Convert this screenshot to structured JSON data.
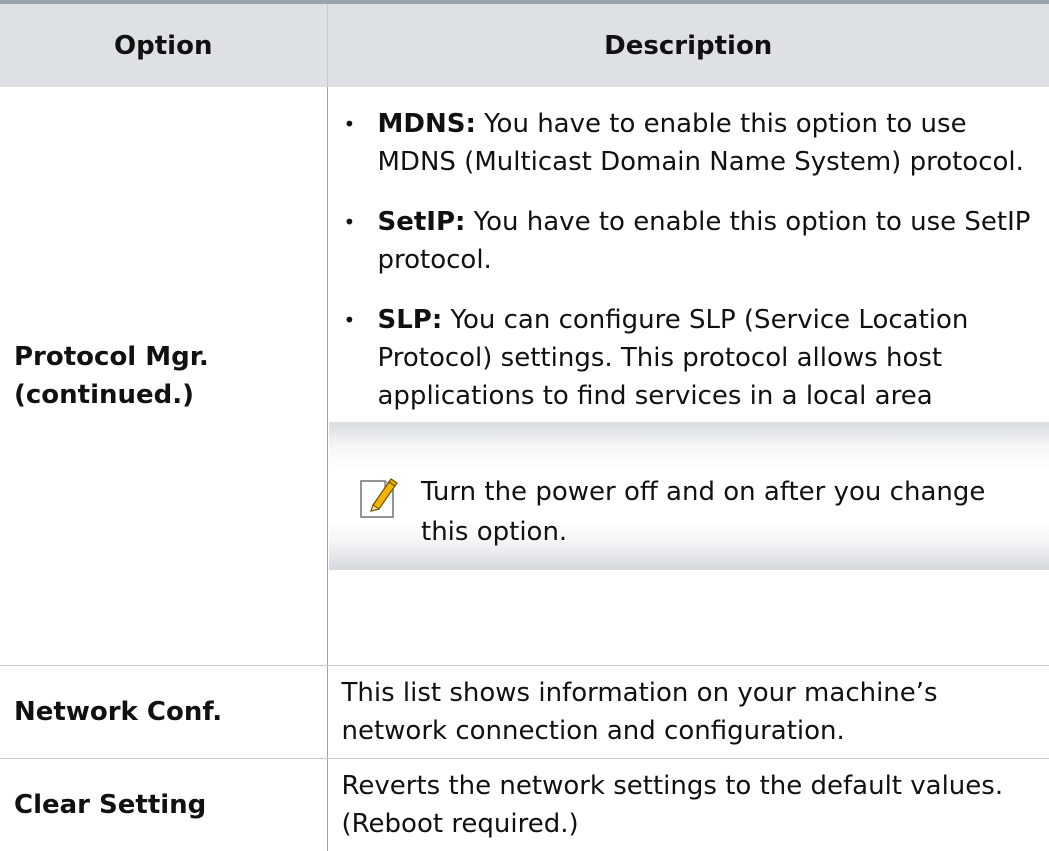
{
  "table": {
    "headers": {
      "option": "Option",
      "description": "Description"
    },
    "rows": [
      {
        "option": "Protocol Mgr. (continued.)",
        "bullets": [
          {
            "term": "MDNS:",
            "text": " You have to enable this option to use MDNS (Multicast Domain Name System) protocol."
          },
          {
            "term": "SetIP:",
            "text": " You have to enable this option to use SetIP protocol."
          },
          {
            "term": "SLP:",
            "text": " You can configure SLP (Service Location Protocol) settings. This protocol allows host applications to find services in a local area network without prior configuration."
          }
        ],
        "note": "Turn the power off and on after you change this option."
      },
      {
        "option": "Network Conf.",
        "description": "This list shows information on your machine’s network connection and configuration."
      },
      {
        "option": "Clear Setting",
        "description": "Reverts the network settings to the default values. (Reboot required.)"
      }
    ]
  },
  "icons": {
    "note": "note-pencil-icon"
  },
  "colors": {
    "header_bg": "#dde1e6",
    "header_rule": "#9aa2ad",
    "row_rule": "#c4c8cd",
    "note_icon_accent": "#f2b400"
  }
}
